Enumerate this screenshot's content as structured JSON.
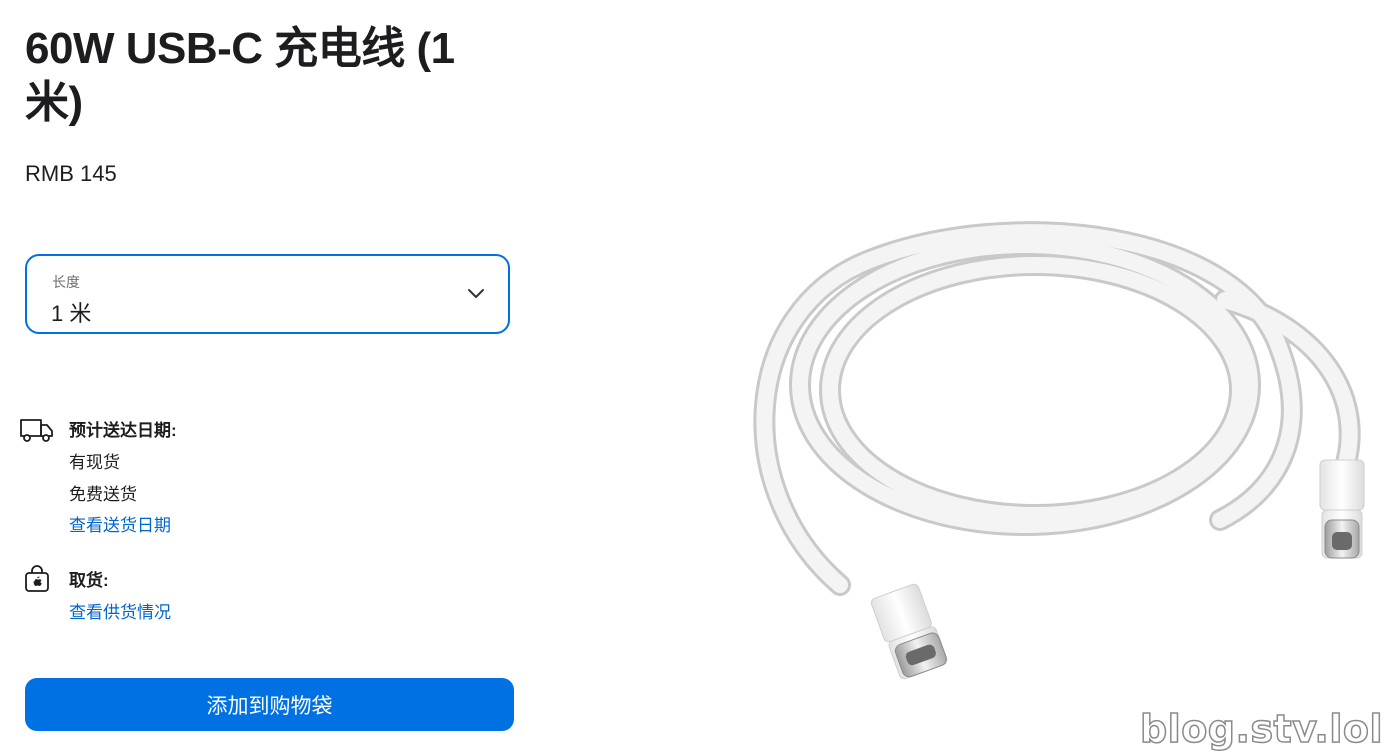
{
  "product": {
    "title": "60W USB-C 充电线 (1 米)",
    "price": "RMB 145"
  },
  "length_select": {
    "label": "长度",
    "value": "1 米"
  },
  "delivery": {
    "heading": "预计送达日期:",
    "lines": [
      "有现货",
      "免费送货"
    ],
    "link": "查看送货日期",
    "icon": "truck-icon"
  },
  "pickup": {
    "heading": "取货:",
    "link": "查看供货情况",
    "icon": "store-bag-icon"
  },
  "add_button": "添加到购物袋",
  "watermark": "blog.stv.lol",
  "colors": {
    "accent": "#0071e3",
    "link": "#0066cc",
    "text": "#1d1d1f"
  }
}
